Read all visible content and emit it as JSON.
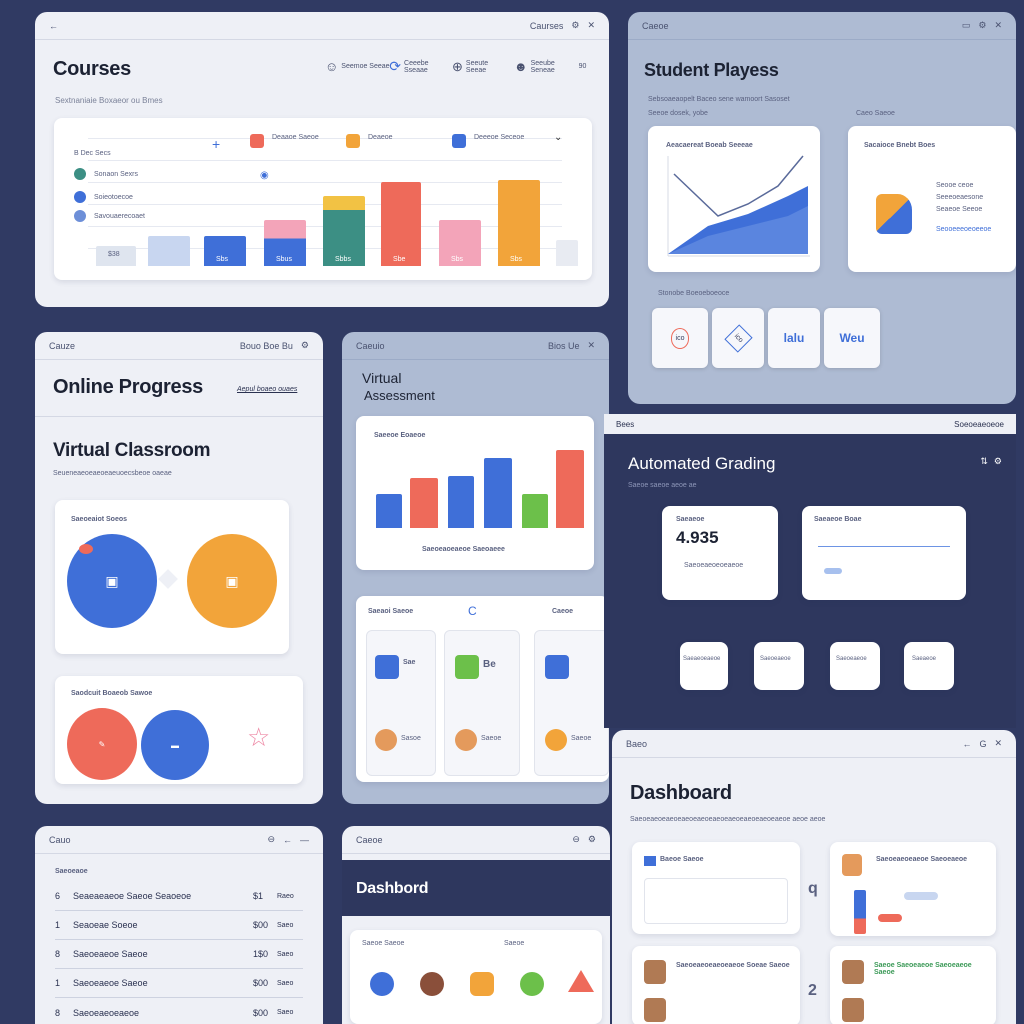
{
  "colors": {
    "background": "#303a63",
    "panel_light": "#eef0f6",
    "panel_blue": "#aebbd3",
    "panel_navy": "#2e375e",
    "accent_blue": "#3f6fd8",
    "accent_orange": "#f2a43a",
    "accent_red": "#ee6a5a",
    "accent_teal": "#3c8f84",
    "accent_pink": "#f3a4b9",
    "accent_green": "#6cc04a"
  },
  "courses": {
    "back": "←",
    "top_right": "Caurses",
    "title": "Courses",
    "subtitle": "Sextnaniaie Boxaeor ou Bmes",
    "header_icons": [
      {
        "icon": "person-icon",
        "label": "Seemoe Seeae"
      },
      {
        "icon": "refresh-icon",
        "label": "Ceeebe Sseaae"
      },
      {
        "icon": "download-icon",
        "label": "Seeute Seeae"
      },
      {
        "icon": "group-icon",
        "label": "Seeube Seneae"
      }
    ],
    "header_extra": "90",
    "chart_side_labels": [
      "B Dec Secs",
      "Sonaon Sexrs",
      "Soieotoecoe",
      "Savouaerecoaet"
    ],
    "legend": [
      "Deaaoe Saeoe",
      "Deaeoe",
      "Deeeoe Seceoe"
    ],
    "bar_labels": [
      "$38",
      "",
      "Sbs",
      "Sbus",
      "Sbbs",
      "Sbe",
      "Sbs",
      "Sbs",
      ""
    ]
  },
  "student": {
    "top_left": "Caeoe",
    "title": "Student Playess",
    "subtitle": "Sebsoaeaopelt Baceo sene wamoort Sasoset",
    "subtitle2": "Seeoe dosek, yobe",
    "card1_title": "Aeacaereat Boeab Seeeae",
    "card2_label": "Caeo Saeoe",
    "card2_title": "Sacaioce Bnebt Boes",
    "card2_lines": [
      "Seooe ceoe",
      "Seeeoeaesone",
      "Seaeoe Seeoe",
      "Seooeeeoeoeeoe"
    ],
    "section_label": "Stonobe Boeoeboeoce",
    "chips": [
      "ico",
      "ico",
      "lalu",
      "Weu"
    ]
  },
  "online": {
    "top_left": "Cauze",
    "top_right": "Bouo Boe Bu",
    "title": "Online Progress",
    "link": "Aepul boaeo ouaes",
    "title2": "Virtual Classroom",
    "subtitle": "Seueneaeoeaeoeaeuoecsbeoe oaeae",
    "card1_title": "Saeoeaiot Soeos",
    "card2_title": "Saodcuit Boaeob Sawoe"
  },
  "virtual": {
    "top_left": "Caeuio",
    "top_right": "Bios Ue",
    "title_line1": "Virtual",
    "title_line2": "Assessment",
    "chart_title": "Saeeoe Eoaeoe",
    "chart_caption": "Saeoeaoeaeoe Saeoaeee",
    "section_left": "Saeaoi Saeoe",
    "section_right": "Caeoe",
    "tiles": [
      {
        "badge": "Sae",
        "name": "Sasoe"
      },
      {
        "badge": "Be",
        "name": "Saeoe"
      },
      {
        "badge": "Seoe",
        "name": "Saeoe"
      }
    ]
  },
  "grading": {
    "top_left": "Bees",
    "top_right": "Soeoeaeoeoe",
    "title": "Automated Grading",
    "subtitle": "Saeoe saeoe aeoe ae",
    "stat_label": "Saeaeoe",
    "stat_value": "4.935",
    "stat_caption": "Saeoeaeoeoeaeoe",
    "chart_label": "Saeaeoe Boae",
    "small_cards": [
      "Saeaeoeaeoe",
      "Saeoeaeoe",
      "Saeoeaeoe",
      "Saeaeoe"
    ]
  },
  "dashboard_right": {
    "top_left": "Baeo",
    "title": "Dashboard",
    "subtitle": "Saeoeaeoeaeoeaeoeaeoeaeoeaeoeaeoeaeoeaeoe aeoe aeoe",
    "card1_title": "Baeoe Saeoe",
    "card2_title": "Saeoeaeoeaeoe Saeoeaeoe",
    "row1_title": "Saeoeaeoeaeoeaeoe Soeae Saeoe",
    "row2_title": "Saeoe Saeoeaeoe Saeoeaeoe Saeoe",
    "big_numbers": [
      "q",
      "2"
    ]
  },
  "list_panel": {
    "top_left": "Cauo",
    "title": "Saeoeaoe",
    "rows": [
      {
        "num": "6",
        "name": "Seaeaeaeoe Saeoe Seaoeoe",
        "val": "$1",
        "tail": "Raeo"
      },
      {
        "num": "1",
        "name": "Seaoeae Soeoe",
        "val": "$00",
        "tail": "Saeo"
      },
      {
        "num": "8",
        "name": "Saeoeaeoe Saeoe",
        "val": "1$0",
        "tail": "Saeo"
      },
      {
        "num": "1",
        "name": "Saeoeaeoe Saeoe",
        "val": "$00",
        "tail": "Saeo"
      },
      {
        "num": "8",
        "name": "Saeoeaeoeaeoe",
        "val": "$00",
        "tail": "Saeo"
      }
    ]
  },
  "dashboard_bottom": {
    "top_left": "Caeoe",
    "top_right": "Baeoe",
    "title": "Dashbord",
    "label_left": "Saeoe Saeoe",
    "label_right": "Saeoe"
  }
}
